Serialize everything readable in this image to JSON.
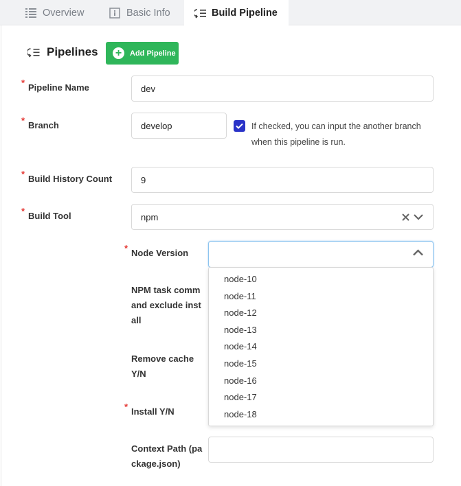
{
  "tabs": [
    {
      "label": "Overview",
      "icon": "list-icon"
    },
    {
      "label": "Basic Info",
      "icon": "info-icon"
    },
    {
      "label": "Build Pipeline",
      "icon": "pipeline-icon"
    }
  ],
  "section": {
    "title": "Pipelines",
    "add_button": "Add Pipeline"
  },
  "form": {
    "pipeline_name": {
      "label": "Pipeline Name",
      "value": "dev"
    },
    "branch": {
      "label": "Branch",
      "value": "develop",
      "checked": true,
      "hint_line1": "If checked, you can input the another branch",
      "hint_line2": "when this pipeline is run."
    },
    "history": {
      "label": "Build History Count",
      "value": "9"
    },
    "build_tool": {
      "label": "Build Tool",
      "value": "npm"
    },
    "node_version": {
      "label": "Node Version",
      "options": [
        "node-10",
        "node-11",
        "node-12",
        "node-13",
        "node-14",
        "node-15",
        "node-16",
        "node-17",
        "node-18"
      ]
    },
    "npm_task": {
      "line1": "NPM task comm",
      "line2": "and exclude inst",
      "line3": "all"
    },
    "remove_cache": {
      "line1": "Remove cache",
      "line2": "Y/N"
    },
    "install": {
      "label": "Install Y/N"
    },
    "context_path": {
      "line1": "Context Path (pa",
      "line2": "ckage.json)"
    }
  },
  "colors": {
    "accent_green": "#2fb65a",
    "checkbox_blue": "#2a33c8",
    "required_red": "#e53935",
    "focus_blue": "#8cc4ef"
  }
}
